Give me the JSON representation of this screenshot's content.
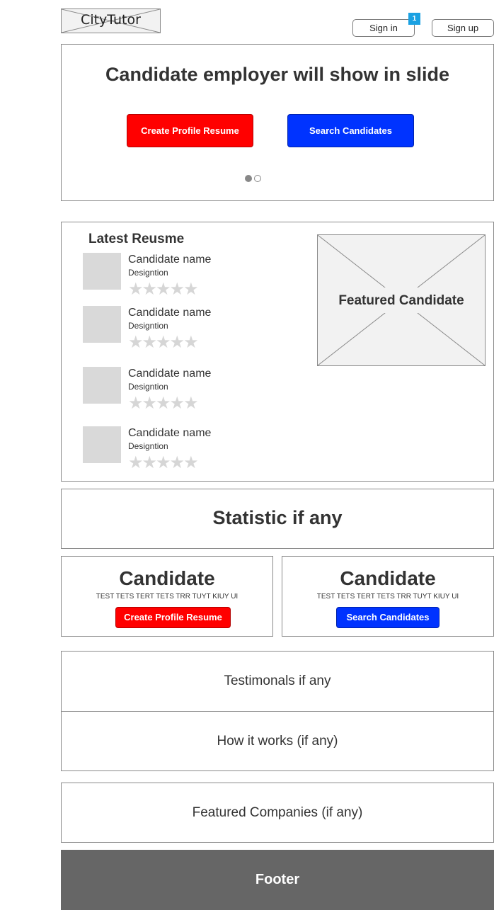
{
  "header": {
    "logo_text": "CityTutor",
    "sign_in_label": "Sign in",
    "sign_in_badge": "1",
    "sign_up_label": "Sign up"
  },
  "hero": {
    "title": "Candidate employer will show in slide",
    "create_button": "Create Profile Resume",
    "search_button": "Search Candidates",
    "slide_count": 2,
    "active_slide": 1
  },
  "latest": {
    "title": "Latest Reusme",
    "items": [
      {
        "name": "Candidate name",
        "designation": "Designtion",
        "stars": "★★★★★",
        "rating": 0
      },
      {
        "name": "Candidate name",
        "designation": "Designtion",
        "stars": "★★★★★",
        "rating": 0
      },
      {
        "name": "Candidate name",
        "designation": "Designtion",
        "stars": "★★★★★",
        "rating": 0
      },
      {
        "name": "Candidate name",
        "designation": "Designtion",
        "stars": "★★★★★",
        "rating": 0
      }
    ],
    "featured_label": "Featured Candidate"
  },
  "statistic": {
    "title": "Statistic if any"
  },
  "cta": [
    {
      "title": "Candidate",
      "subtitle": "TEST TETS TERT TETS TRR TUYT KIUY UI",
      "button": "Create Profile Resume"
    },
    {
      "title": "Candidate",
      "subtitle": "TEST TETS TERT TETS TRR TUYT KIUY UI",
      "button": "Search Candidates"
    }
  ],
  "testimonials": {
    "title": "Testimonals if any"
  },
  "how_it_works": {
    "title": "How it works (if any)"
  },
  "featured_companies": {
    "title": "Featured Companies (if any)"
  },
  "footer": {
    "label": "Footer"
  },
  "colors": {
    "primary_red": "#ff0000",
    "primary_blue": "#0033ff",
    "badge_blue": "#1ba1e2",
    "footer_gray": "#666666",
    "placeholder_gray": "#d9d9d9"
  }
}
